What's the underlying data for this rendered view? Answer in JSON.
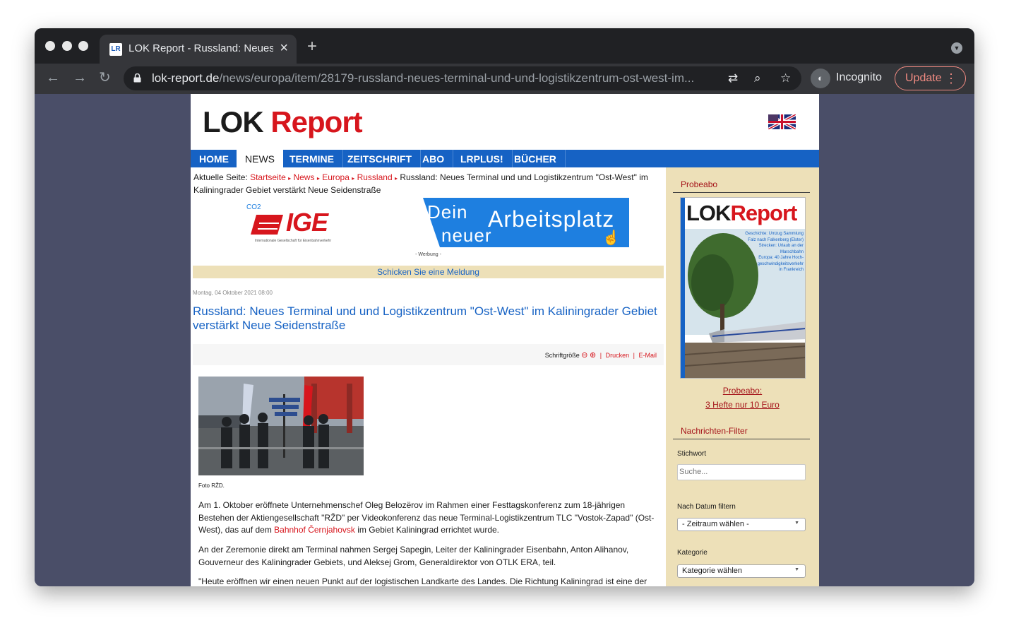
{
  "browser": {
    "tab_title": "LOK Report - Russland: Neues Terminal",
    "tab_favicon": "LR",
    "url_host": "lok-report.de",
    "url_path": "/news/europa/item/28179-russland-neues-terminal-und-und-logistikzentrum-ost-west-im...",
    "incognito_label": "Incognito",
    "update_label": "Update"
  },
  "site": {
    "logo_lok": "LOK",
    "logo_report": "Report",
    "menu": [
      "HOME",
      "NEWS",
      "TERMINE",
      "ZEITSCHRIFT",
      "ABO",
      "LRPLUS!",
      "BÜCHER"
    ],
    "active_menu": "NEWS"
  },
  "breadcrumb": {
    "prefix": "Aktuelle Seite:",
    "items": [
      "Startseite",
      "News",
      "Europa",
      "Russland"
    ],
    "current": "Russland: Neues Terminal und und Logistikzentrum \"Ost-West\" im Kaliningrader Gebiet verstärkt Neue Seidenstraße"
  },
  "ad": {
    "co2": "CO2",
    "brand": "IGE",
    "brand_sub": "Internationale Gesellschaft für Eisenbahnverkehr",
    "line1": "Dein",
    "line2": "Arbeitsplatz",
    "line3": "neuer",
    "label": "- Werbung -"
  },
  "meldung": "Schicken Sie eine Meldung",
  "article": {
    "date": "Montag, 04 Oktober 2021 08:00",
    "title": "Russland: Neues Terminal und und Logistikzentrum \"Ost-West\" im Kaliningrader Gebiet verstärkt Neue Seidenstraße",
    "tools_label": "Schriftgröße",
    "print_label": "Drucken",
    "email_label": "E-Mail",
    "photo_caption": "Foto RŽD.",
    "p1_before": "Am 1. Oktober eröffnete Unternehmenschef Oleg Belozërov im Rahmen einer Festtagskonferenz zum 18-jährigen Bestehen der Aktiengesellschaft \"RŽD\" per Videokonferenz das neue Terminal-Logistikzentrum TLC \"Vostok-Zapad\" (Ost-West), das auf dem ",
    "p1_link": "Bahnhof Černjahovsk",
    "p1_after": " im Gebiet Kaliningrad errichtet wurde.",
    "p2": "An der Zeremonie direkt am Terminal nahmen Sergej Sapegin, Leiter der Kaliningrader Eisenbahn, Anton Alihanov, Gouverneur des Kaliningrader Gebiets, und Aleksej Grom, Generaldirektor von OTLK ERA, teil.",
    "p3": "\"Heute eröffnen wir einen neuen Punkt auf der logistischen Landkarte des Landes. Die Richtung Kaliningrad ist eine der"
  },
  "sidebar": {
    "probeabo_heading": "Probeabo",
    "cover": {
      "logo_lok": "LOK",
      "logo_report": "Report",
      "lines": [
        "Geschichte: Umzug Sammlung",
        "Falz nach Falkenberg (Elster)",
        "Strecken: Urlaub an der",
        "Marschbahn",
        "Europa: 40 Jahre Hoch-",
        "geschwindigkeitsverkehr",
        "in Frankreich"
      ]
    },
    "probeabo_link1": "Probeabo:",
    "probeabo_link2": "3 Hefte nur 10 Euro",
    "filter_heading": "Nachrichten-Filter",
    "keyword_label": "Stichwort",
    "search_placeholder": "Suche...",
    "date_label": "Nach Datum filtern",
    "date_select": "- Zeitraum wählen -",
    "category_label": "Kategorie",
    "category_select": "Kategorie wählen"
  },
  "colors": {
    "nav_blue": "#1662c4",
    "accent_red": "#d7161d",
    "sidebar_bg": "#ede0b8"
  }
}
